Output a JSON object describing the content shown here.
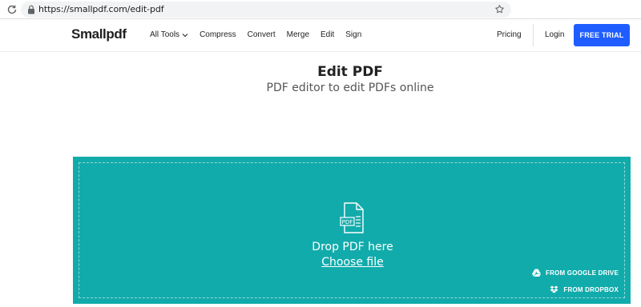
{
  "browser": {
    "url": "https://smallpdf.com/edit-pdf"
  },
  "header": {
    "logo": "Smallpdf",
    "nav": [
      "All Tools",
      "Compress",
      "Convert",
      "Merge",
      "Edit",
      "Sign"
    ],
    "pricing": "Pricing",
    "login": "Login",
    "cta": "FREE TRIAL"
  },
  "hero": {
    "title": "Edit PDF",
    "subtitle": "PDF editor to edit PDFs online"
  },
  "dropzone": {
    "icon_label": "PDF",
    "drop_text": "Drop PDF here",
    "choose_file": "Choose file",
    "google_drive": "FROM GOOGLE DRIVE",
    "dropbox": "FROM DROPBOX"
  },
  "colors": {
    "accent": "#1f5dff",
    "dropzone": "#11abab"
  }
}
